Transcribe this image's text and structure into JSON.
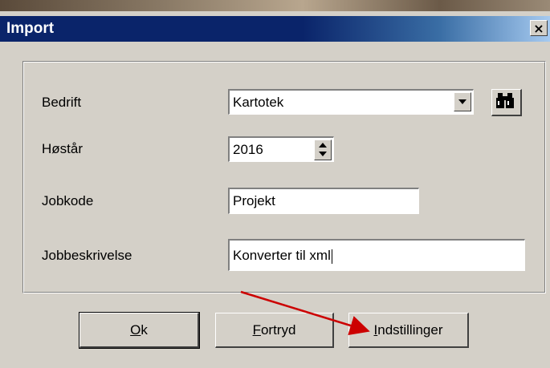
{
  "window": {
    "title": "Import",
    "close_glyph": "×"
  },
  "form": {
    "company": {
      "label": "Bedrift",
      "value": "Kartotek"
    },
    "harvest_year": {
      "label": "Høstår",
      "value": "2016"
    },
    "job_code": {
      "label": "Jobkode",
      "value": "Projekt"
    },
    "job_description": {
      "label": "Jobbeskrivelse",
      "value": "Konverter til xml"
    }
  },
  "buttons": {
    "ok": {
      "mnemonic": "O",
      "rest": "k"
    },
    "cancel": {
      "mnemonic": "F",
      "rest": "ortryd"
    },
    "settings": {
      "mnemonic": "I",
      "rest": "ndstillinger"
    }
  },
  "icons": {
    "search": "binoculars-icon"
  },
  "colors": {
    "titlebar": "#0a246a",
    "dialog_bg": "#d4d0c8",
    "annotation_arrow": "#cc0000"
  }
}
